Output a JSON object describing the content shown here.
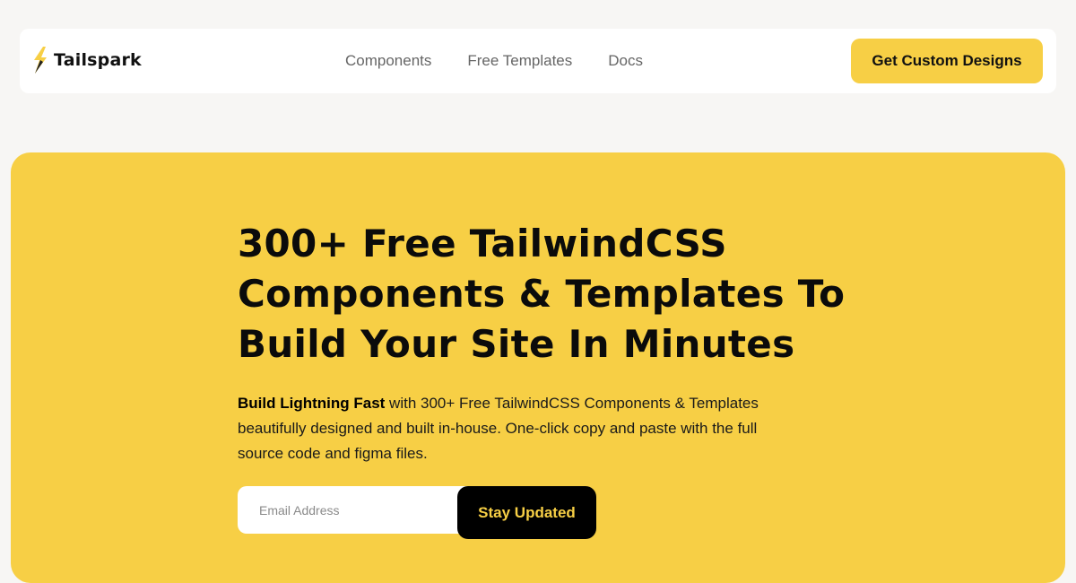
{
  "brand": {
    "name": "Tailspark",
    "logo_icon": "lightning-bolt-icon",
    "accent_color": "#f7cf45"
  },
  "nav": {
    "links": [
      "Components",
      "Free Templates",
      "Docs"
    ],
    "cta_label": "Get Custom Designs"
  },
  "hero": {
    "title_lines": [
      "300+ Free TailwindCSS",
      "Components & Templates To",
      "Build Your Site In Minutes"
    ],
    "desc_bold": "Build Lightning Fast",
    "desc_rest": " with 300+ Free TailwindCSS Components & Templates beautifully designed and built in-house. One-click copy and paste with the full source code and figma files.",
    "email_placeholder": "Email Address",
    "email_value": "",
    "subscribe_label": "Stay Updated"
  }
}
